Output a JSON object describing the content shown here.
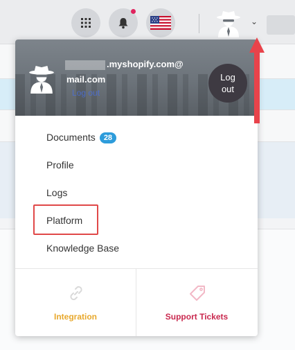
{
  "topbar": {
    "icons": [
      "apps-grid-icon",
      "bell-icon",
      "us-flag-icon",
      "spy-avatar-icon",
      "chevron-down-icon"
    ],
    "caret": "⌄"
  },
  "account": {
    "email_line1": ".myshopify.com@",
    "email_line2": "mail.com",
    "logout_link": "Log out",
    "logout_button": "Log out"
  },
  "menu": {
    "items": [
      {
        "label": "Documents",
        "badge": "28"
      },
      {
        "label": "Profile"
      },
      {
        "label": "Logs"
      },
      {
        "label": "Platform"
      },
      {
        "label": "Knowledge Base"
      }
    ]
  },
  "footer": {
    "integration_label": "Integration",
    "support_label": "Support Tickets"
  },
  "colors": {
    "accent_blue": "#2d9cdb",
    "integration": "#e8a82c",
    "support": "#c9284e",
    "highlight_red": "#e04848"
  }
}
